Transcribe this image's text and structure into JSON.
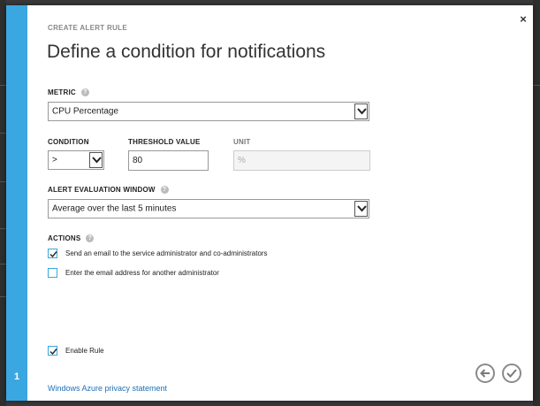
{
  "dialog": {
    "subtitle": "CREATE ALERT RULE",
    "title": "Define a condition for notifications",
    "close_glyph": "×",
    "step_number": "1"
  },
  "metric": {
    "label": "METRIC",
    "selected": "CPU Percentage"
  },
  "condition": {
    "label": "CONDITION",
    "selected": ">"
  },
  "threshold": {
    "label": "THRESHOLD VALUE",
    "value": "80"
  },
  "unit": {
    "label": "UNIT",
    "value": "%"
  },
  "evaluation_window": {
    "label": "ALERT EVALUATION WINDOW",
    "selected": "Average over the last 5 minutes"
  },
  "actions": {
    "label": "ACTIONS",
    "items": [
      {
        "label": "Send an email to the service administrator and co-administrators",
        "checked": true
      },
      {
        "label": "Enter the email address for another administrator",
        "checked": false
      }
    ]
  },
  "enable_rule": {
    "label": "Enable Rule",
    "checked": true
  },
  "footer": {
    "privacy_link": "Windows Azure privacy statement"
  },
  "help_glyph": "?",
  "colors": {
    "accent": "#3aa7e0",
    "link": "#1f6fb5"
  },
  "icons": {
    "close": "close-icon",
    "help": "help-icon",
    "dropdown": "chevron-down-icon",
    "check": "check-icon",
    "back": "arrow-left-icon",
    "confirm": "checkmark-icon"
  }
}
